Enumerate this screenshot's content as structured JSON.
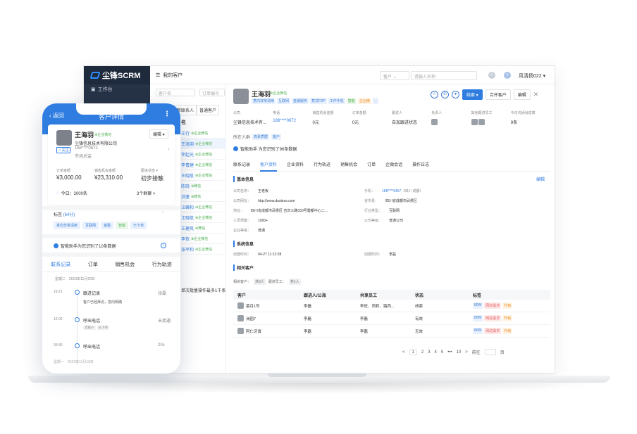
{
  "desktop": {
    "logo": "尘锋SCRM",
    "sidebar": {
      "workbench": "工作台"
    },
    "breadcrumb": "我的客户",
    "search": {
      "type": "客户",
      "placeholder": "请输入名称"
    },
    "user": "风清扬022 ▾",
    "list": {
      "search_placeholder": "客户名",
      "order_placeholder": "订单编号",
      "tabs": [
        "帮联系人",
        "普通客户"
      ],
      "name_header": "名",
      "rows": [
        {
          "name": "王行",
          "tag": "企业微信"
        },
        {
          "name": "王海羽",
          "tag": "企业微信"
        },
        {
          "name": "李起光",
          "tag": "企业微信"
        },
        {
          "name": "李青建",
          "tag": "企业微信"
        },
        {
          "name": "王晓航",
          "tag": "企业微信"
        },
        {
          "name": "陈晓",
          "tag": "微信"
        },
        {
          "name": "洪蓬",
          "tag": "微信"
        },
        {
          "name": "汪峰和",
          "tag": "企业微信"
        },
        {
          "name": "江晓航",
          "tag": "企业微信"
        },
        {
          "name": "王建风",
          "tag": "微信"
        },
        {
          "name": "李依",
          "tag": "企业微信"
        },
        {
          "name": "张平和",
          "tag": "企业微信"
        }
      ],
      "footer": "单次批量操作最多1千条"
    },
    "detail": {
      "name": "王海羽",
      "source": "企业微信",
      "tags": [
        {
          "text": "意向非常清晰",
          "style": "b"
        },
        {
          "text": "互联网",
          "style": "b"
        },
        {
          "text": "金融服务",
          "style": "b"
        },
        {
          "text": "意式PZP",
          "style": "b"
        },
        {
          "text": "工作手机",
          "style": "b"
        },
        {
          "text": "智能",
          "style": "g"
        },
        {
          "text": "企业微",
          "style": "o"
        },
        {
          "text": "...",
          "style": "b"
        }
      ],
      "actions": {
        "main": "线索",
        "merge": "合并客户",
        "edit": "编辑"
      },
      "stats": [
        {
          "label": "公司",
          "value": "尘锋信息技术有..."
        },
        {
          "label": "电话",
          "value": "188****0672"
        },
        {
          "label": "销售机会金额",
          "value": "0元"
        },
        {
          "label": "订单金额",
          "value": "0元"
        },
        {
          "label": "跟进人",
          "value": "自加跟进状态"
        },
        {
          "label": "负责人",
          "value": ""
        },
        {
          "label": "其他跟进员工",
          "value": ""
        },
        {
          "label": "今日沟通消息数",
          "value": "9条"
        }
      ],
      "belong": {
        "label": "所在人群",
        "chips": [
          "高素质群",
          "客户"
        ]
      },
      "smart": "智能助手 为您识别了96条数据",
      "tabs": [
        "联系记录",
        "客户资料",
        "企业资料",
        "行为轨迹",
        "销售机会",
        "订单",
        "企微会话",
        "操作日志"
      ],
      "active_tab": "客户资料",
      "basic_title": "基本信息",
      "edit_label": "编辑",
      "basic": {
        "company_name": {
          "k": "公司名称：",
          "v": "王老板"
        },
        "website": {
          "k": "公司网址：",
          "v": "http://www.dustess.com"
        },
        "address": {
          "k": "地址：",
          "v": "四川省成都市武侯区 吉庆三路333号蜀都中心二..."
        },
        "staff": {
          "k": "人员规模：",
          "v": "1000+"
        },
        "trade": {
          "k": "企业等级：",
          "v": "普通"
        },
        "phone": {
          "k": "手机：",
          "v": "188****9457",
          "extra": "（四川 成都）"
        },
        "province": {
          "k": "省市县：",
          "v": "四川省成都市武侯区"
        },
        "industry": {
          "k": "行业类型：",
          "v": "互联网"
        },
        "company_level": {
          "k": "公司等级：",
          "v": "普通公司"
        }
      },
      "system_title": "系统信息",
      "system": {
        "created": {
          "k": "创建时间：",
          "v": "04-27 11:12:28"
        },
        "creator": {
          "k": "创建时间：",
          "v": "李磊"
        }
      },
      "related_title": "相关客户",
      "sub_filters": {
        "a": "相关客户：",
        "a_chip": "共3人",
        "b": "跟进员工：",
        "b_chip": "共1人"
      },
      "table": {
        "headers": [
          "客户",
          "跟进人/公海",
          "共享员工",
          "状态",
          "标签"
        ],
        "rows": [
          {
            "name": "慕月1号",
            "owner": "李磊",
            "shared": "李旺、莉莉、路西...",
            "status": "线索",
            "tags": [
              "80W",
              "网站需求",
              "升级"
            ]
          },
          {
            "name": "洲园7",
            "owner": "李磊",
            "shared": "李磊",
            "status": "有效",
            "tags": [
              "80W",
              "网站需求",
              "升级"
            ]
          },
          {
            "name": "阿仁牙膏",
            "owner": "李磊",
            "shared": "李磊",
            "status": "无效",
            "tags": [
              "80W",
              "网站需求",
              "升级"
            ]
          }
        ]
      },
      "pager": {
        "items": [
          "<",
          "1",
          "2",
          "3",
          "4",
          "5",
          "•••",
          "10",
          ">"
        ],
        "goto": "前往",
        "page_unit": "页"
      }
    }
  },
  "phone": {
    "back": "返回",
    "title": "客户详情",
    "name": "王海羽",
    "source": "企业微信",
    "edit": "编辑 ▾",
    "follow": "☆关注",
    "company": "尘锋信息技术有限公司",
    "phone_num": "188****0672",
    "dept": "市场总监",
    "metrics": [
      {
        "label": "订单金额",
        "value": "¥3,000.00"
      },
      {
        "label": "销售机会金额",
        "value": "¥23,310.00"
      },
      {
        "label": "跟进状态 ▾",
        "value": "初步接触"
      }
    ],
    "today": "今日：2000条",
    "groups": "3个群聊 >",
    "tags_label": "标签",
    "tags_count": "(64分)",
    "tags": [
      "意向非常清晰",
      "互联网",
      "金融",
      "智能",
      "已下单"
    ],
    "smart": "智能助手为您识别了10条数据",
    "tabs": [
      "联系记录",
      "订单",
      "销售机会",
      "行为轨迹"
    ],
    "active_tab": "联系记录",
    "date": "星期二　2019年11月20日",
    "timeline": [
      {
        "time": "19:21",
        "title": "跟进记录",
        "right": "张磊",
        "desc": "客户已经拜访，意向明确",
        "chips": []
      },
      {
        "time": "12:00",
        "title": "呼出电话",
        "right": "未接通",
        "desc": "",
        "chips": [
          "无接户",
          "已下单"
        ]
      },
      {
        "time": "09:30",
        "title": "呼出电话",
        "right": "20s",
        "desc": "",
        "chips": []
      }
    ],
    "bottom": "星期一　2019年11月19日"
  }
}
